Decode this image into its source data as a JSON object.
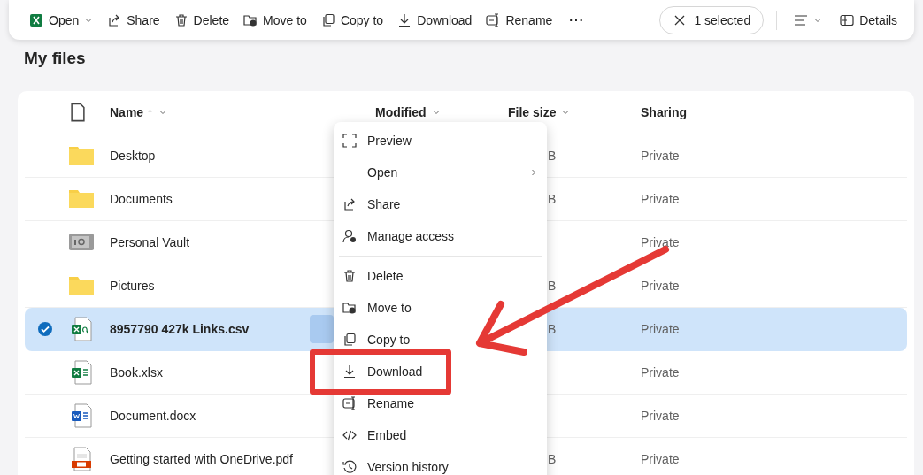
{
  "toolbar": {
    "actions": [
      {
        "kind": "excel",
        "label": "Open",
        "dropdown": true
      },
      {
        "kind": "share",
        "label": "Share",
        "dropdown": false
      },
      {
        "kind": "delete",
        "label": "Delete",
        "dropdown": false
      },
      {
        "kind": "move",
        "label": "Move to",
        "dropdown": false
      },
      {
        "kind": "copy",
        "label": "Copy to",
        "dropdown": false
      },
      {
        "kind": "download",
        "label": "Download",
        "dropdown": false
      },
      {
        "kind": "rename",
        "label": "Rename",
        "dropdown": false
      },
      {
        "kind": "more",
        "label": "···"
      }
    ],
    "selection": {
      "label": "1 selected"
    },
    "details": {
      "label": "Details"
    }
  },
  "title": "My files",
  "table": {
    "columns": [
      {
        "label": "Name",
        "sort_mark": "↑"
      },
      {
        "label": "Modified"
      },
      {
        "label": "File size"
      },
      {
        "label": "Sharing"
      }
    ],
    "rows": [
      {
        "kind": "folder",
        "name": "Desktop",
        "size": "B",
        "sharing": "Private",
        "selected": false
      },
      {
        "kind": "folder",
        "name": "Documents",
        "size": "B",
        "sharing": "Private",
        "selected": false
      },
      {
        "kind": "vault",
        "name": "Personal Vault",
        "sharing": "Private",
        "selected": false
      },
      {
        "kind": "folder",
        "name": "Pictures",
        "size": "B",
        "sharing": "Private",
        "selected": false
      },
      {
        "kind": "csv",
        "name": "8957790 427k Links.csv",
        "size": "B",
        "sharing": "Private",
        "selected": true
      },
      {
        "kind": "xlsx",
        "name": "Book.xlsx",
        "sharing": "Private",
        "selected": false
      },
      {
        "kind": "docx",
        "name": "Document.docx",
        "sharing": "Private",
        "selected": false
      },
      {
        "kind": "pdf",
        "name": "Getting started with OneDrive.pdf",
        "size": "B",
        "sharing": "Private",
        "selected": false
      }
    ]
  },
  "context_menu": {
    "items": [
      {
        "kind": "preview",
        "label": "Preview"
      },
      {
        "kind": "open",
        "label": "Open",
        "submenu": true
      },
      {
        "kind": "share",
        "label": "Share"
      },
      {
        "kind": "access",
        "label": "Manage access"
      },
      {
        "kind": "divider"
      },
      {
        "kind": "delete",
        "label": "Delete"
      },
      {
        "kind": "move",
        "label": "Move to"
      },
      {
        "kind": "copy",
        "label": "Copy to"
      },
      {
        "kind": "download",
        "label": "Download"
      },
      {
        "kind": "rename",
        "label": "Rename"
      },
      {
        "kind": "embed",
        "label": "Embed"
      },
      {
        "kind": "history",
        "label": "Version history"
      }
    ]
  }
}
